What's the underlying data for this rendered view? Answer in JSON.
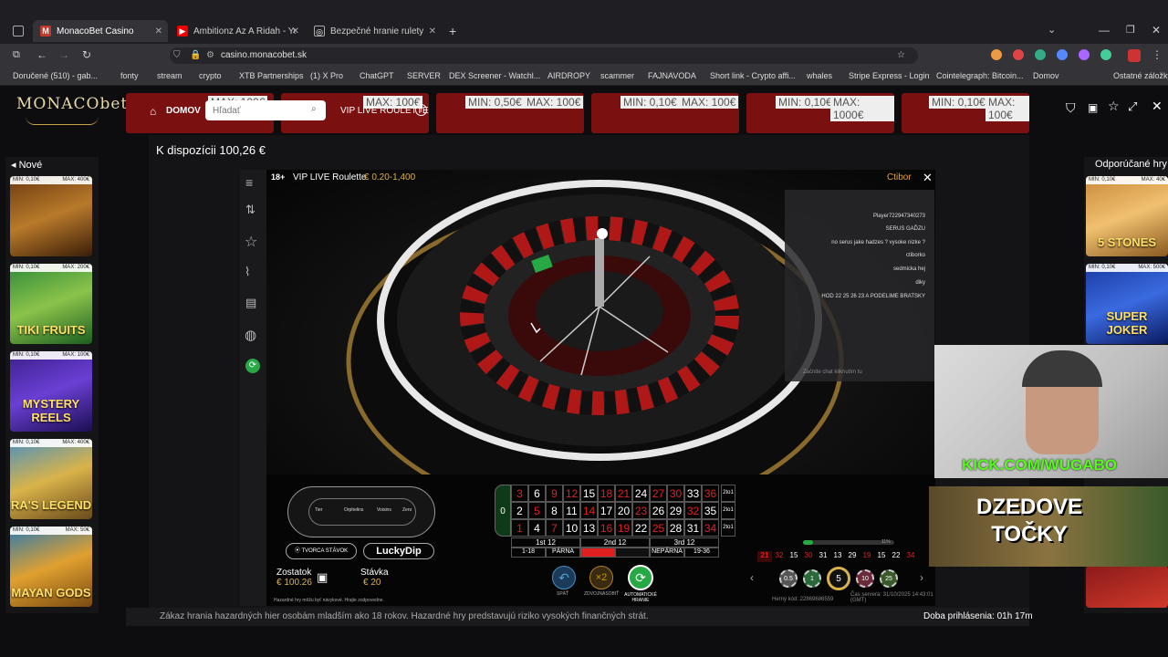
{
  "browser": {
    "tabs": [
      {
        "label": "MonacoBet Casino",
        "active": true
      },
      {
        "label": "Ambitionz Az A Ridah - YouTube",
        "active": false
      },
      {
        "label": "Bezpečné hranie rulety",
        "active": false
      }
    ],
    "url": "casino.monacobet.sk",
    "bookmarks": [
      "Doručené (510) - gab...",
      "fonty",
      "stream",
      "crypto",
      "XTB Partnerships",
      "(1) X Pro",
      "ChatGPT",
      "SERVER",
      "DEX Screener - Watchl...",
      "AIRDROPY",
      "scammer",
      "FAJNAVODA",
      "Short link - Crypto affi...",
      "whales",
      "Stripe Express - Login",
      "Cointelegraph: Bitcoin...",
      "Domov",
      "Ostatné záložky"
    ]
  },
  "site": {
    "logo": "MONACObet",
    "nav_home": "DOMOV",
    "search_placeholder": "Hľadať",
    "vip_label": "VIP LIVE ROULETTE",
    "left_section": "Nové",
    "right_section": "Odporúčané hry",
    "left_games": [
      {
        "title": "",
        "min": "MIN: 0,10€",
        "max": "MAX: 400€"
      },
      {
        "title": "TIKI FRUITS",
        "min": "MIN: 0,10€",
        "max": "MAX: 200€"
      },
      {
        "title": "MYSTERY REELS",
        "min": "MIN: 0,10€",
        "max": "MAX: 100€"
      },
      {
        "title": "RA'S LEGEND",
        "min": "MIN: 0,10€",
        "max": "MAX: 400€"
      },
      {
        "title": "MAYAN GODS",
        "min": "MIN: 0,10€",
        "max": "MAX: 50€"
      }
    ],
    "right_games": [
      {
        "title": "5 STONES",
        "min": "MIN: 0,10€",
        "max": "MAX: 40€"
      },
      {
        "title": "SUPER JOKER",
        "min": "MIN: 0,10€",
        "max": "MAX: 500€"
      }
    ],
    "top_games": [
      {
        "min": "MIN: 0,50€",
        "max": "MAX: 100€"
      },
      {
        "min": "MIN: 0,10€",
        "max": "MAX: 100€"
      },
      {
        "min": "MIN: 0,10€",
        "max": "MAX: 1000€"
      },
      {
        "min": "MIN: 0,10€",
        "max": "MAX: 100€"
      }
    ],
    "bottom_notice": "Zákaz hrania hazardných hier osobám mladším ako 18 rokov. Hazardné hry predstavujú riziko vysokých finančných strát.",
    "session_time": "Doba prihlásenia: 01h 17m"
  },
  "modal": {
    "balance_title": "K dispozícii 100,26 €"
  },
  "game": {
    "age_badge": "18+",
    "title": "VIP LIVE Roulette",
    "limits": "€ 0.20-1,400",
    "user": "Ctibor",
    "chat": [
      "Player722947340273",
      "SERUS GAĎZU",
      "no serus jake hadzes ? vysoke nizke ?",
      "ctiborko",
      "sedmicka hej",
      "diky",
      "HOD 22 25 26 23 A PODELIME BRATSKY"
    ],
    "chat_placeholder": "Začnite chat kliknutím tu",
    "balance_label": "Zostatok",
    "balance_value": "€ 100.26",
    "stake_label": "Stávka",
    "stake_value": "€ 20",
    "create_bet": "TVORCA STÁVOK",
    "luckydip": "LuckyDip",
    "undo": "SPÄŤ",
    "double": "ZDVOJNÁSOBIŤ",
    "auto": "AUTOMATICKÉ HRANIE",
    "disclaimer": "Hazardné hry môžu byť návykové. Hrajte zodpovedne.",
    "game_code": "Herný kód: 22869686559",
    "server_time": "Čas servera: 31/10/2025 14:43:01 (GMT)",
    "progress_pct": "11%",
    "history": [
      "21",
      "32",
      "15",
      "30",
      "31",
      "13",
      "29",
      "19",
      "15",
      "22",
      "34"
    ],
    "chips": [
      "0.5",
      "1",
      "5",
      "10",
      "25"
    ],
    "race_labels": [
      "Tier",
      "Orphelins",
      "Voisins",
      "Zero"
    ],
    "dozens": [
      "1st 12",
      "2nd 12",
      "3rd 12"
    ],
    "outside": [
      "1-18",
      "PÁRNA",
      "",
      "",
      "NEPÁRNA",
      "19-36"
    ],
    "col_label": "2to1",
    "zero": "0",
    "table_rows": [
      [
        "3",
        "6",
        "9",
        "12",
        "15",
        "18",
        "21",
        "24",
        "27",
        "30",
        "33",
        "36"
      ],
      [
        "2",
        "5",
        "8",
        "11",
        "14",
        "17",
        "20",
        "23",
        "26",
        "29",
        "32",
        "35"
      ],
      [
        "1",
        "4",
        "7",
        "10",
        "13",
        "16",
        "19",
        "22",
        "25",
        "28",
        "31",
        "34"
      ]
    ]
  },
  "stream": {
    "kick": "KICK.COM/WUGABO",
    "promo": "DZEDOVE TOČKY"
  },
  "colors": {
    "red": "#e02020",
    "green": "#27a845",
    "gold": "#c9a44a"
  }
}
